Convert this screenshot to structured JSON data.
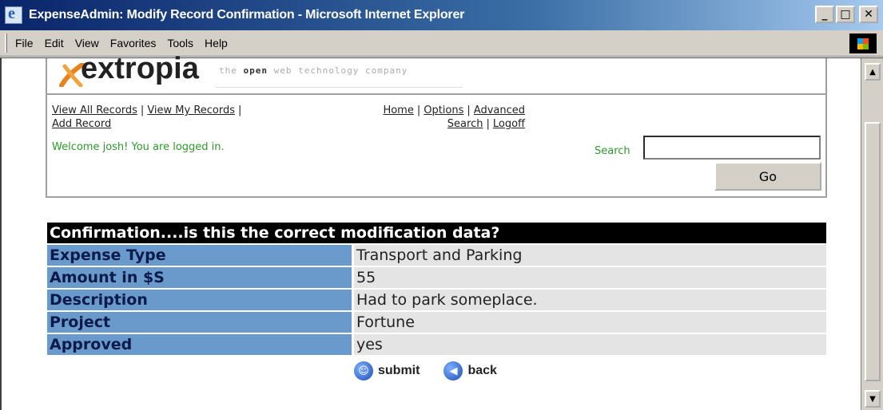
{
  "window": {
    "title": "ExpenseAdmin: Modify Record Confirmation - Microsoft Internet Explorer",
    "minimize": "_",
    "maximize": "□",
    "close": "✕"
  },
  "menu": [
    "File",
    "Edit",
    "View",
    "Favorites",
    "Tools",
    "Help"
  ],
  "logo": {
    "word": "extropia",
    "tag_pre": "the ",
    "tag_bold": "open",
    "tag_post": " web technology company"
  },
  "nav": {
    "view_all": "View All Records",
    "view_my": "View My Records",
    "add_record": "Add Record",
    "home": "Home",
    "options": "Options",
    "advanced_search": "Advanced Search",
    "logoff": "Logoff",
    "separator": "|"
  },
  "welcome": "Welcome josh! You are logged in.",
  "search": {
    "label": "Search",
    "value": "",
    "go_label": "Go"
  },
  "confirmation": {
    "header": "Confirmation....is this the correct modification data?",
    "rows": [
      {
        "label": "Expense Type",
        "value": "Transport and Parking"
      },
      {
        "label": "Amount in $S",
        "value": "55"
      },
      {
        "label": "Description",
        "value": "Had to park someplace."
      },
      {
        "label": "Project",
        "value": "Fortune"
      },
      {
        "label": "Approved",
        "value": "yes"
      }
    ],
    "submit_label": "submit",
    "back_label": "back"
  },
  "colors": {
    "green_text": "#2a9a2a",
    "label_bg": "#6a9acb",
    "value_bg": "#e4e4e4"
  },
  "icons": {
    "submit": "smiley-icon",
    "back": "back-arrow-icon"
  }
}
